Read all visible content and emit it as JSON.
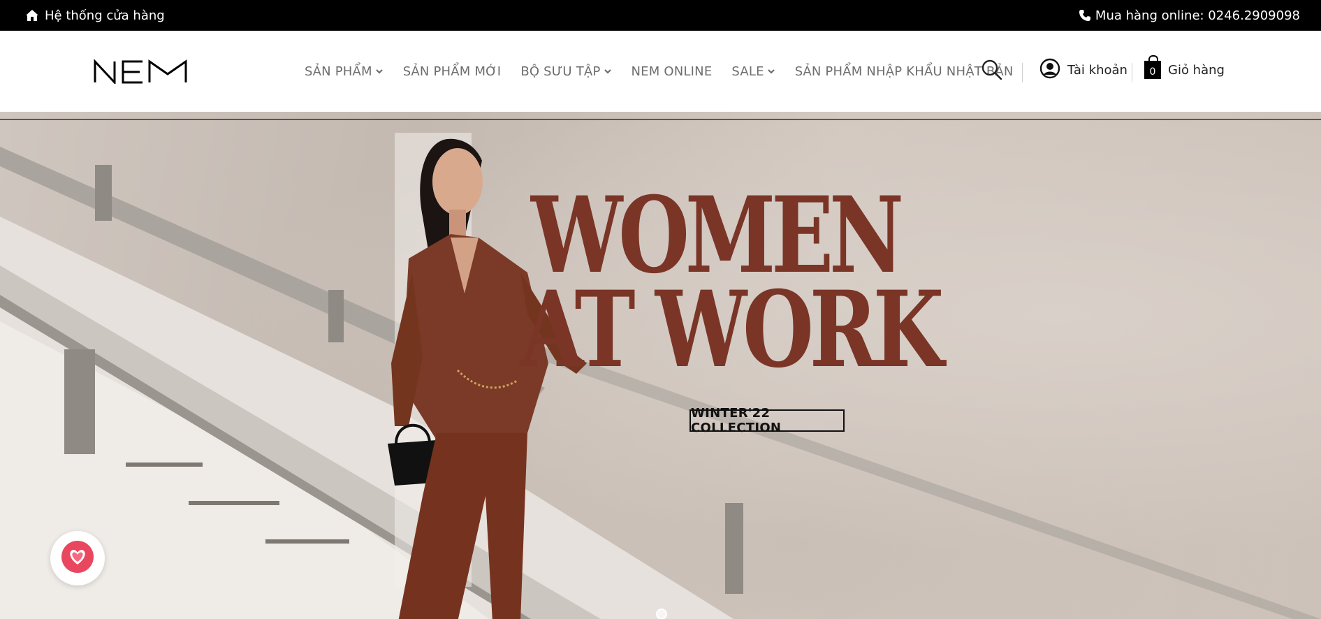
{
  "topbar": {
    "stores_label": "Hệ thống cửa hàng",
    "hotline_label": "Mua hàng online: 0246.2909098"
  },
  "header": {
    "logo_text": "NEM",
    "nav": [
      {
        "label": "SẢN PHẨM",
        "has_dropdown": true
      },
      {
        "label": "SẢN PHẨM MỚI",
        "has_dropdown": false
      },
      {
        "label": "BỘ SƯU TẬP",
        "has_dropdown": true
      },
      {
        "label": "NEM ONLINE",
        "has_dropdown": false
      },
      {
        "label": "SALE",
        "has_dropdown": true
      },
      {
        "label": "SẢN PHẨM NHẬP KHẨU NHẬT BẢN",
        "has_dropdown": false
      }
    ],
    "account_label": "Tài khoản",
    "cart_label": "Giỏ hàng",
    "cart_count": "0"
  },
  "hero": {
    "headline_line1": "WOMEN",
    "headline_line2": "AT WORK",
    "collection_label": "WINTER'22 COLLECTION"
  },
  "colors": {
    "topbar_bg": "#000000",
    "nav_text": "#6d6d6d",
    "headline": "#7a3526",
    "favorite": "#e8475f"
  },
  "icons": [
    "home-icon",
    "phone-icon",
    "search-icon",
    "user-icon",
    "cart-icon",
    "chevron-down-icon",
    "heart-icon"
  ]
}
